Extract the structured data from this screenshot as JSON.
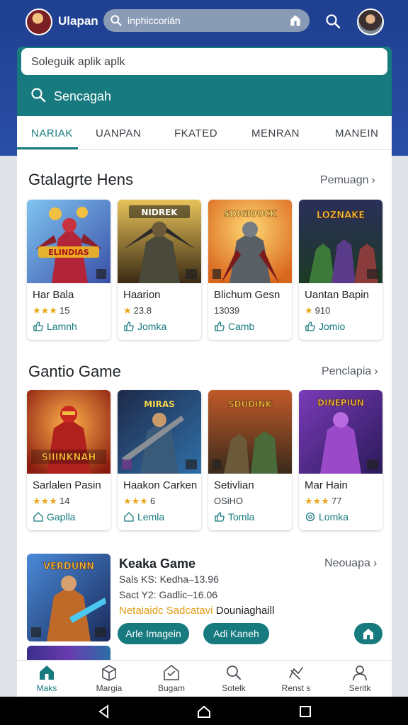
{
  "header": {
    "brand": "Ulapan",
    "search_text": "inphiccorián"
  },
  "search": {
    "placeholder": "Soleguik aplik aplk",
    "bar_label": "Sencagah"
  },
  "tabs": [
    "NARIAK",
    "UANPAN",
    "FKATED",
    "MENRAN",
    "MANEIN"
  ],
  "sections": [
    {
      "title": "Gtalagrte Hens",
      "more": "Pemuagn",
      "cards": [
        {
          "name": "Har Bala",
          "rating": "15",
          "action": "Lamnh",
          "art_text": "ELINDIAS"
        },
        {
          "name": "Haarion",
          "rating": "23.8",
          "action": "Jomka",
          "art_text": "NIDREK"
        },
        {
          "name": "Blichum Gesn",
          "rating": "13039",
          "action": "Camb",
          "art_text": "SDIGIDUCK"
        },
        {
          "name": "Uantan Bapin",
          "rating": "910",
          "action": "Jomio",
          "art_text": "LOZNAKE"
        }
      ]
    },
    {
      "title": "Gantio Game",
      "more": "Penclapia",
      "cards": [
        {
          "name": "Sarlalen Pasin",
          "rating": "14",
          "action": "Gaplla",
          "art_text": "SIIINKNAH"
        },
        {
          "name": "Haakon Carken",
          "rating": "6",
          "action": "Lemla",
          "art_text": "MIRAS"
        },
        {
          "name": "Setivlian",
          "rating": "OSiHO",
          "action": "Tomla",
          "art_text": "SDUDINK"
        },
        {
          "name": "Mar Hain",
          "rating": "77",
          "action": "Lomka",
          "art_text": "DINEPIUN"
        }
      ]
    }
  ],
  "featured": {
    "title": "Keaka Game",
    "more": "Neouapa",
    "line1": "Sals KS: Kedha–13.96",
    "line2": "Sact Y2: Gadlic–16.06",
    "highlight_a": "Netaiaidc Sadcatavi",
    "highlight_b": "Douniaghaill",
    "btn1": "Arle Imagein",
    "btn2": "Adi Kaneh",
    "art_text": "VERDUNN"
  },
  "bottom_nav": [
    "Maks",
    "Margia",
    "Bugam",
    "Sotelk",
    "Renst s",
    "Seritk"
  ]
}
